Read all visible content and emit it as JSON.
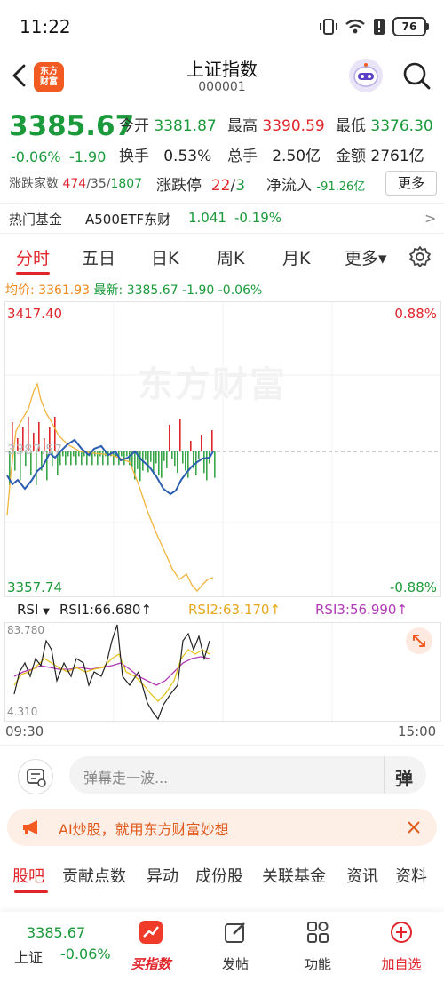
{
  "status_bar": {
    "time": "11:22",
    "battery": "76"
  },
  "header": {
    "title": "上证指数",
    "code": "000001",
    "logo_line1": "东方",
    "logo_line2": "财富"
  },
  "quote": {
    "price": "3385.67",
    "change_pct": "-0.06%",
    "change": "-1.90",
    "open_label": "今开",
    "open": "3381.87",
    "high_label": "最高",
    "high": "3390.59",
    "low_label": "最低",
    "low": "3376.30",
    "turnover_label": "换手",
    "turnover": "0.53%",
    "volume_label": "总手",
    "volume": "2.50亿",
    "amount_label": "金额",
    "amount": "2761亿",
    "breadth_label": "涨跌家数",
    "up": "474",
    "flat": "35",
    "down": "1807",
    "limit_label": "涨跌停",
    "limit_up": "22",
    "limit_down": "3",
    "inflow_label": "净流入",
    "inflow": "-91.26亿",
    "more_label": "更多"
  },
  "hot_fund": {
    "label": "热门基金",
    "name": "A500ETF东财",
    "price": "1.041",
    "change": "-0.19%",
    "arrow": ">"
  },
  "tabs": [
    {
      "label": "分时",
      "active": true
    },
    {
      "label": "五日"
    },
    {
      "label": "日K"
    },
    {
      "label": "周K"
    },
    {
      "label": "月K"
    },
    {
      "label": "更多▾"
    }
  ],
  "avg_line": {
    "avg_label": "均价:",
    "avg": "3361.93",
    "latest_label": "最新:",
    "latest": "3385.67",
    "chg": "-1.90",
    "pct": "-0.06%"
  },
  "chart_labels": {
    "y_top": "3417.40",
    "y_bottom": "3357.74",
    "y_mid": "3387.57",
    "pct_top": "0.88%",
    "pct_bottom": "-0.88%",
    "watermark": "东方财富",
    "time_start": "09:30",
    "time_end": "15:00"
  },
  "rsi": {
    "selector": "RSI",
    "rsi1": "RSI1:66.680↑",
    "rsi2": "RSI2:63.170↑",
    "rsi3": "RSI3:56.990↑",
    "top": "83.780",
    "bottom": "4.310"
  },
  "comment": {
    "placeholder": "弹幕走一波...",
    "danmu_char": "弹"
  },
  "ai_banner": {
    "text": "AI炒股，就用东方财富妙想"
  },
  "bottom_tabs": [
    {
      "label": "股吧",
      "active": true
    },
    {
      "label": "贡献点数"
    },
    {
      "label": "异动"
    },
    {
      "label": "成份股"
    },
    {
      "label": "关联基金"
    },
    {
      "label": "资讯"
    },
    {
      "label": "资料"
    }
  ],
  "bottom_nav": {
    "price": "3385.67",
    "name": "上证",
    "pct": "-0.06%",
    "buy_label": "买指数",
    "post_label": "发帖",
    "func_label": "功能",
    "add_label": "加自选"
  },
  "colors": {
    "up": "#e0252b",
    "down": "#1a9a3a",
    "price_line": "#2a5db0",
    "avg_line": "#f0b43c",
    "brand": "#f25a22"
  }
}
